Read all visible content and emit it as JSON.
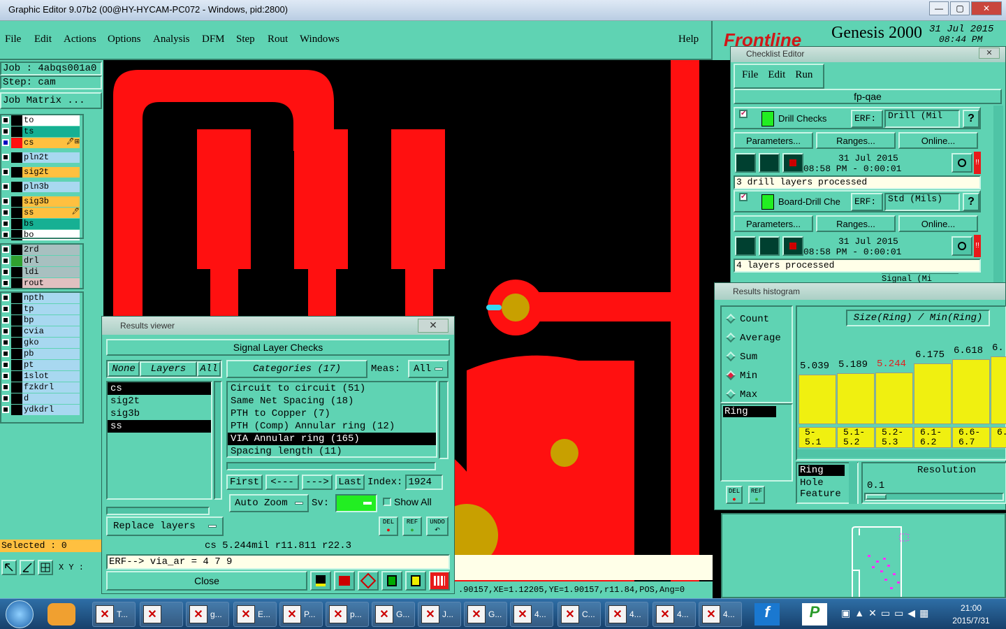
{
  "window": {
    "title": "Graphic Editor 9.07b2 (00@HY-HYCAM-PC072 - Windows, pid:2800)",
    "min": "—",
    "max": "▢",
    "close": "✕"
  },
  "menu": [
    "File",
    "Edit",
    "Actions",
    "Options",
    "Analysis",
    "DFM",
    "Step",
    "Rout",
    "Windows"
  ],
  "help": "Help",
  "brand": {
    "logo": "Frontline",
    "product": "Genesis 2000",
    "date": "31 Jul 2015",
    "time": "08:44 PM"
  },
  "job": {
    "job": "Job : 4abqs001a0",
    "step": "Step: cam",
    "matrix": "Job Matrix ..."
  },
  "layers": [
    {
      "name": "to",
      "color": "#000",
      "bg": "#ffffff"
    },
    {
      "name": "ts",
      "color": "#000",
      "bg": "#16b093"
    },
    {
      "name": "cs",
      "color": "#ff1010",
      "bg": "#ffc040",
      "mark": "🖊⊞",
      "active": true
    },
    {
      "name": "pln2t",
      "color": "#000",
      "bg": "#a8d8f0"
    },
    {
      "name": "sig2t",
      "color": "#000",
      "bg": "#ffc040"
    },
    {
      "name": "pln3b",
      "color": "#000",
      "bg": "#a8d8f0"
    },
    {
      "name": "sig3b",
      "color": "#000",
      "bg": "#ffc040"
    },
    {
      "name": "ss",
      "color": "#000",
      "bg": "#ffc040",
      "mark": "🖊"
    },
    {
      "name": "bs",
      "color": "#000",
      "bg": "#16b093"
    },
    {
      "name": "bo",
      "color": "#000",
      "bg": "#ffffff"
    },
    {
      "name": "2rd",
      "color": "#000",
      "bg": "#a8c0c0"
    },
    {
      "name": "drl",
      "color": "#30a030",
      "bg": "#a8c0c0"
    },
    {
      "name": "ldi",
      "color": "#000",
      "bg": "#a8c0c0"
    },
    {
      "name": "rout",
      "color": "#000",
      "bg": "#e0c0c0"
    },
    {
      "name": "npth",
      "color": "#000",
      "bg": "#a8d8f0"
    },
    {
      "name": "tp",
      "color": "#000",
      "bg": "#a8d8f0"
    },
    {
      "name": "bp",
      "color": "#000",
      "bg": "#a8d8f0"
    },
    {
      "name": "cvia",
      "color": "#000",
      "bg": "#a8d8f0"
    },
    {
      "name": "gko",
      "color": "#000",
      "bg": "#a8d8f0"
    },
    {
      "name": "pb",
      "color": "#000",
      "bg": "#a8d8f0"
    },
    {
      "name": "pt",
      "color": "#000",
      "bg": "#a8d8f0"
    },
    {
      "name": "1slot",
      "color": "#000",
      "bg": "#a8d8f0"
    },
    {
      "name": "fzkdrl",
      "color": "#000",
      "bg": "#a8d8f0"
    },
    {
      "name": "d",
      "color": "#000",
      "bg": "#a8d8f0"
    },
    {
      "name": "ydkdrl",
      "color": "#000",
      "bg": "#a8d8f0"
    }
  ],
  "selected": "Selected : 0",
  "xy_label": "X Y :",
  "coords": ".90157,XE=1.12205,YE=1.90157,r11.84,POS,Ang=0",
  "results_viewer": {
    "title": "Results viewer",
    "heading": "Signal Layer Checks",
    "none": "None",
    "layers": "Layers",
    "all": "All",
    "categories": "Categories (17)",
    "meas": "Meas:",
    "meas_val": "All",
    "layer_list": [
      {
        "t": "cs",
        "sel": true
      },
      {
        "t": "sig2t",
        "sel": false
      },
      {
        "t": "sig3b",
        "sel": false
      },
      {
        "t": "ss",
        "sel": true
      }
    ],
    "cat_list": [
      {
        "t": "Circuit to circuit (51)",
        "sel": false
      },
      {
        "t": "Same Net Spacing (18)",
        "sel": false
      },
      {
        "t": "PTH to Copper (7)",
        "sel": false
      },
      {
        "t": "PTH (Comp) Annular ring (12)",
        "sel": false
      },
      {
        "t": "VIA Annular ring (165)",
        "sel": true
      },
      {
        "t": "Spacing length (11)",
        "sel": false
      }
    ],
    "first": "First",
    "prev": "<---",
    "next": "--->",
    "last": "Last",
    "index_label": "Index:",
    "index": "1924",
    "autozoom": "Auto Zoom",
    "sv": "Sv:",
    "showall": "Show All",
    "replace": "Replace layers",
    "del": "DEL",
    "ref": "REF",
    "undo": "UNDO",
    "status": "cs 5.244mil   r11.811  r22.3",
    "erf": "ERF--> via_ar = 4 7 9",
    "close": "Close"
  },
  "checklist": {
    "title": "Checklist Editor",
    "menu": [
      "File",
      "Edit",
      "Run"
    ],
    "name": "fp-qae",
    "checks": [
      {
        "label": "Drill Checks",
        "erf_label": "ERF:",
        "erf": "Drill (Mil",
        "params": "Parameters...",
        "ranges": "Ranges...",
        "online": "Online...",
        "date": "31 Jul 2015",
        "time": "08:58 PM - 0:00:01",
        "msg": "3 drill layers processed"
      },
      {
        "label": "Board-Drill Che",
        "erf_label": "ERF:",
        "erf": "Std (Mils)",
        "params": "Parameters...",
        "ranges": "Ranges...",
        "online": "Online...",
        "date": "31 Jul 2015",
        "time": "08:58 PM - 0:00:01",
        "msg": "4 layers processed"
      }
    ],
    "peek": "Signal (Mi"
  },
  "histogram": {
    "title": "Results histogram",
    "options": [
      {
        "t": "Count",
        "on": false
      },
      {
        "t": "Average",
        "on": false
      },
      {
        "t": "Sum",
        "on": false
      },
      {
        "t": "Min",
        "on": true
      },
      {
        "t": "Max",
        "on": false
      }
    ],
    "heading": "Size(Ring) / Min(Ring)",
    "bars": [
      {
        "v": "5.039",
        "lo": "5-",
        "hi": "5.1",
        "h": 0.71,
        "hl": false
      },
      {
        "v": "5.189",
        "lo": "5.1-",
        "hi": "5.2",
        "h": 0.73,
        "hl": false
      },
      {
        "v": "5.244",
        "lo": "5.2-",
        "hi": "5.3",
        "h": 0.74,
        "hl": true
      },
      {
        "v": "6.175",
        "lo": "6.1-",
        "hi": "6.2",
        "h": 0.87,
        "hl": false
      },
      {
        "v": "6.618",
        "lo": "6.6-",
        "hi": "6.7",
        "h": 0.93,
        "hl": false
      },
      {
        "v": "6.",
        "lo": "6.",
        "hi": "",
        "h": 0.97,
        "hl": false
      }
    ],
    "list_sel": "Ring",
    "axis": [
      "Ring",
      "Hole",
      "Feature"
    ],
    "resolution_label": "Resolution",
    "resolution": "0.1",
    "del": "DEL",
    "ref": "REF"
  },
  "taskbar": {
    "items": [
      "T...",
      "",
      "g...",
      "E...",
      "P...",
      "p...",
      "G...",
      "J...",
      "G...",
      "4...",
      "C...",
      "4...",
      "4...",
      "4..."
    ],
    "time": "21:00",
    "date": "2015/7/31"
  }
}
